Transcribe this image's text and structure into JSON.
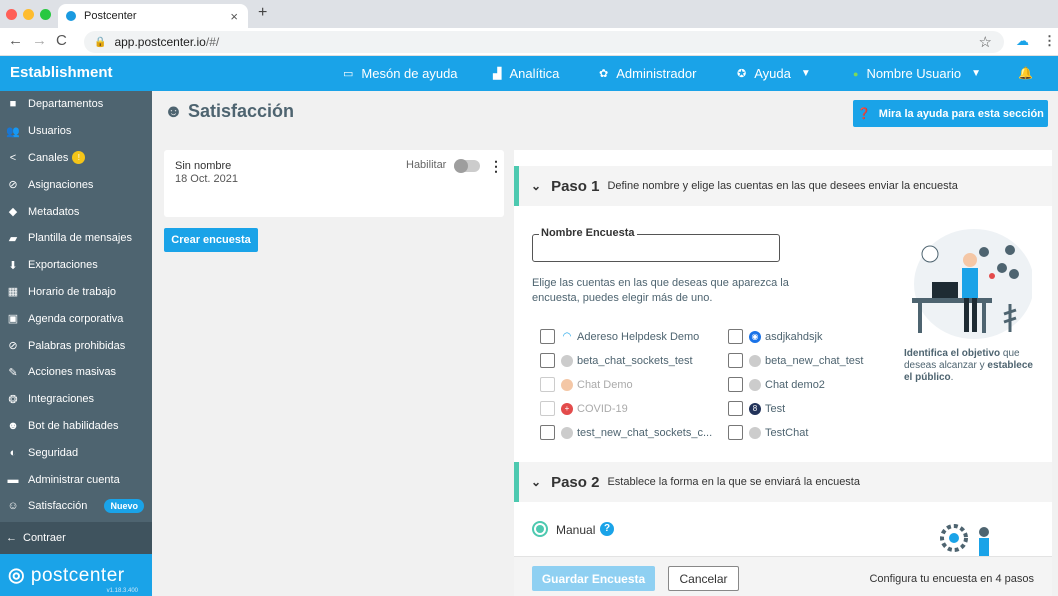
{
  "browser": {
    "tab_title": "Postcenter",
    "tab_close": "×",
    "new_tab": "+",
    "url_host": "app.postcenter.io",
    "url_path": "/#/"
  },
  "topbar": {
    "brand": "Establishment",
    "nav": [
      {
        "label": "Mesón de ayuda",
        "icon": "monitor-icon"
      },
      {
        "label": "Analítica",
        "icon": "chart-icon"
      },
      {
        "label": "Administrador",
        "icon": "gear-icon"
      },
      {
        "label": "Ayuda",
        "icon": "lifebuoy-icon"
      },
      {
        "label": "Nombre Usuario",
        "icon": "status-dot-icon"
      }
    ],
    "status_color": "#7ed957"
  },
  "sidebar": {
    "items": [
      {
        "label": "Departamentos",
        "icon": "briefcase-icon"
      },
      {
        "label": "Usuarios",
        "icon": "users-icon"
      },
      {
        "label": "Canales",
        "icon": "share-icon",
        "badge": "!"
      },
      {
        "label": "Asignaciones",
        "icon": "check-circle-icon"
      },
      {
        "label": "Metadatos",
        "icon": "tag-icon"
      },
      {
        "label": "Plantilla de mensajes",
        "icon": "edit-icon"
      },
      {
        "label": "Exportaciones",
        "icon": "download-icon"
      },
      {
        "label": "Horario de trabajo",
        "icon": "calendar-icon"
      },
      {
        "label": "Agenda corporativa",
        "icon": "id-card-icon"
      },
      {
        "label": "Palabras prohibidas",
        "icon": "ban-icon"
      },
      {
        "label": "Acciones masivas",
        "icon": "wrench-icon"
      },
      {
        "label": "Integraciones",
        "icon": "puzzle-icon"
      },
      {
        "label": "Bot de habilidades",
        "icon": "robot-icon"
      },
      {
        "label": "Seguridad",
        "icon": "shield-icon"
      },
      {
        "label": "Administrar cuenta",
        "icon": "credit-card-icon"
      },
      {
        "label": "Satisfacción",
        "icon": "smile-icon",
        "badge": "Nuevo"
      }
    ],
    "collapse_label": "Contraer",
    "logo": "postcenter",
    "version": "v1.18.3.400"
  },
  "main": {
    "title": "Satisfacción",
    "help_button": "Mira la ayuda para esta sección",
    "survey_card": {
      "name": "Sin nombre",
      "date": "18 Oct. 2021",
      "enable_label": "Habilitar",
      "enabled": false
    },
    "create_button": "Crear encuesta"
  },
  "editor": {
    "step1": {
      "number": "Paso 1",
      "description": "Define nombre y elige las cuentas en las que desees enviar la encuesta",
      "name_label": "Nombre Encuesta",
      "name_value": "",
      "hint": "Elige las cuentas en las que deseas que aparezca la encuesta, puedes elegir más de uno.",
      "accounts": [
        {
          "label": "Adereso Helpdesk Demo",
          "disabled": false
        },
        {
          "label": "asdjkahdsjk",
          "disabled": false
        },
        {
          "label": "beta_chat_sockets_test",
          "disabled": false
        },
        {
          "label": "beta_new_chat_test",
          "disabled": false
        },
        {
          "label": "Chat Demo",
          "disabled": true
        },
        {
          "label": "Chat demo2",
          "disabled": false
        },
        {
          "label": "COVID-19",
          "disabled": true
        },
        {
          "label": "Test",
          "disabled": false
        },
        {
          "label": "test_new_chat_sockets_c...",
          "disabled": false
        },
        {
          "label": "TestChat",
          "disabled": false
        }
      ],
      "illustration_text_bold1": "Identifica el objetivo",
      "illustration_text_mid": " que deseas alcanzar y ",
      "illustration_text_bold2": "establece el público",
      "illustration_text_end": "."
    },
    "step2": {
      "number": "Paso 2",
      "description": "Establece la forma en la que se enviará la encuesta",
      "option_manual": "Manual",
      "manual_selected": true
    },
    "footer": {
      "save_button": "Guardar Encuesta",
      "cancel_button": "Cancelar",
      "note": "Configura tu encuesta en 4 pasos"
    }
  },
  "colors": {
    "accent": "#1aa3e8",
    "sidebar": "#4e6470",
    "step_border": "#4dc9b0"
  }
}
